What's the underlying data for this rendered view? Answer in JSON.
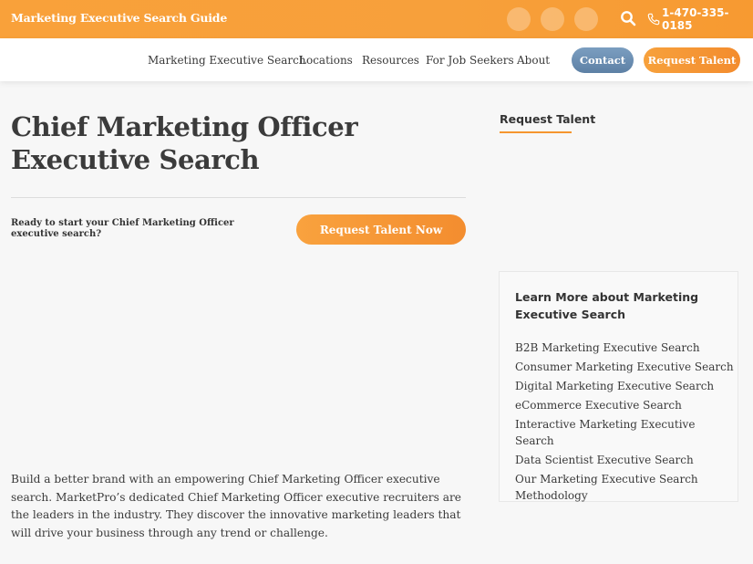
{
  "topbar": {
    "site_title": "Marketing Executive Search Guide",
    "phone": "1-470-335-0185",
    "social_icons": [
      "social-icon-1",
      "social-icon-2",
      "social-icon-3"
    ]
  },
  "nav": {
    "items": [
      {
        "label": "Marketing Executive Search"
      },
      {
        "label": "Locations"
      },
      {
        "label": "Resources"
      },
      {
        "label": "For Job Seekers"
      },
      {
        "label": "About"
      }
    ],
    "contact_label": "Contact",
    "request_label": "Request Talent"
  },
  "main": {
    "title": "Chief Marketing Officer Executive Search",
    "cta_text": "Ready to start your Chief Marketing Officer executive search?",
    "cta_button": "Request Talent Now",
    "body": "Build a better brand with an empowering Chief Marketing Officer executive search. MarketPro’s dedicated Chief Marketing Officer executive recruiters are the leaders in the industry. They discover the innovative marketing leaders that will drive your business through any trend or challenge."
  },
  "sidebar": {
    "request_heading": "Request Talent",
    "learn_title": "Learn More about Marketing Executive Search",
    "links": [
      "B2B Marketing Executive Search",
      "Consumer Marketing Executive Search",
      "Digital Marketing Executive Search",
      "eCommerce Executive Search",
      "Interactive Marketing Executive Search",
      "Data Scientist Executive Search",
      "Our Marketing Executive Search Methodology"
    ]
  },
  "colors": {
    "brand_orange": "#f7a03b",
    "contact_blue": "#6a8db3",
    "accent_underline": "#f5962f"
  }
}
